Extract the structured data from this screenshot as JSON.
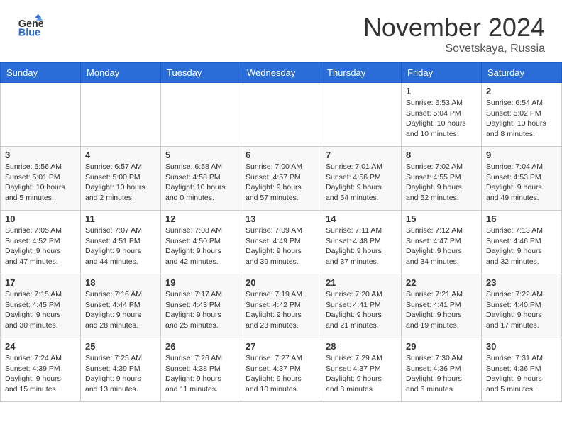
{
  "header": {
    "logo_general": "General",
    "logo_blue": "Blue",
    "month": "November 2024",
    "location": "Sovetskaya, Russia"
  },
  "weekdays": [
    "Sunday",
    "Monday",
    "Tuesday",
    "Wednesday",
    "Thursday",
    "Friday",
    "Saturday"
  ],
  "weeks": [
    [
      {
        "day": "",
        "info": ""
      },
      {
        "day": "",
        "info": ""
      },
      {
        "day": "",
        "info": ""
      },
      {
        "day": "",
        "info": ""
      },
      {
        "day": "",
        "info": ""
      },
      {
        "day": "1",
        "info": "Sunrise: 6:53 AM\nSunset: 5:04 PM\nDaylight: 10 hours\nand 10 minutes."
      },
      {
        "day": "2",
        "info": "Sunrise: 6:54 AM\nSunset: 5:02 PM\nDaylight: 10 hours\nand 8 minutes."
      }
    ],
    [
      {
        "day": "3",
        "info": "Sunrise: 6:56 AM\nSunset: 5:01 PM\nDaylight: 10 hours\nand 5 minutes."
      },
      {
        "day": "4",
        "info": "Sunrise: 6:57 AM\nSunset: 5:00 PM\nDaylight: 10 hours\nand 2 minutes."
      },
      {
        "day": "5",
        "info": "Sunrise: 6:58 AM\nSunset: 4:58 PM\nDaylight: 10 hours\nand 0 minutes."
      },
      {
        "day": "6",
        "info": "Sunrise: 7:00 AM\nSunset: 4:57 PM\nDaylight: 9 hours\nand 57 minutes."
      },
      {
        "day": "7",
        "info": "Sunrise: 7:01 AM\nSunset: 4:56 PM\nDaylight: 9 hours\nand 54 minutes."
      },
      {
        "day": "8",
        "info": "Sunrise: 7:02 AM\nSunset: 4:55 PM\nDaylight: 9 hours\nand 52 minutes."
      },
      {
        "day": "9",
        "info": "Sunrise: 7:04 AM\nSunset: 4:53 PM\nDaylight: 9 hours\nand 49 minutes."
      }
    ],
    [
      {
        "day": "10",
        "info": "Sunrise: 7:05 AM\nSunset: 4:52 PM\nDaylight: 9 hours\nand 47 minutes."
      },
      {
        "day": "11",
        "info": "Sunrise: 7:07 AM\nSunset: 4:51 PM\nDaylight: 9 hours\nand 44 minutes."
      },
      {
        "day": "12",
        "info": "Sunrise: 7:08 AM\nSunset: 4:50 PM\nDaylight: 9 hours\nand 42 minutes."
      },
      {
        "day": "13",
        "info": "Sunrise: 7:09 AM\nSunset: 4:49 PM\nDaylight: 9 hours\nand 39 minutes."
      },
      {
        "day": "14",
        "info": "Sunrise: 7:11 AM\nSunset: 4:48 PM\nDaylight: 9 hours\nand 37 minutes."
      },
      {
        "day": "15",
        "info": "Sunrise: 7:12 AM\nSunset: 4:47 PM\nDaylight: 9 hours\nand 34 minutes."
      },
      {
        "day": "16",
        "info": "Sunrise: 7:13 AM\nSunset: 4:46 PM\nDaylight: 9 hours\nand 32 minutes."
      }
    ],
    [
      {
        "day": "17",
        "info": "Sunrise: 7:15 AM\nSunset: 4:45 PM\nDaylight: 9 hours\nand 30 minutes."
      },
      {
        "day": "18",
        "info": "Sunrise: 7:16 AM\nSunset: 4:44 PM\nDaylight: 9 hours\nand 28 minutes."
      },
      {
        "day": "19",
        "info": "Sunrise: 7:17 AM\nSunset: 4:43 PM\nDaylight: 9 hours\nand 25 minutes."
      },
      {
        "day": "20",
        "info": "Sunrise: 7:19 AM\nSunset: 4:42 PM\nDaylight: 9 hours\nand 23 minutes."
      },
      {
        "day": "21",
        "info": "Sunrise: 7:20 AM\nSunset: 4:41 PM\nDaylight: 9 hours\nand 21 minutes."
      },
      {
        "day": "22",
        "info": "Sunrise: 7:21 AM\nSunset: 4:41 PM\nDaylight: 9 hours\nand 19 minutes."
      },
      {
        "day": "23",
        "info": "Sunrise: 7:22 AM\nSunset: 4:40 PM\nDaylight: 9 hours\nand 17 minutes."
      }
    ],
    [
      {
        "day": "24",
        "info": "Sunrise: 7:24 AM\nSunset: 4:39 PM\nDaylight: 9 hours\nand 15 minutes."
      },
      {
        "day": "25",
        "info": "Sunrise: 7:25 AM\nSunset: 4:39 PM\nDaylight: 9 hours\nand 13 minutes."
      },
      {
        "day": "26",
        "info": "Sunrise: 7:26 AM\nSunset: 4:38 PM\nDaylight: 9 hours\nand 11 minutes."
      },
      {
        "day": "27",
        "info": "Sunrise: 7:27 AM\nSunset: 4:37 PM\nDaylight: 9 hours\nand 10 minutes."
      },
      {
        "day": "28",
        "info": "Sunrise: 7:29 AM\nSunset: 4:37 PM\nDaylight: 9 hours\nand 8 minutes."
      },
      {
        "day": "29",
        "info": "Sunrise: 7:30 AM\nSunset: 4:36 PM\nDaylight: 9 hours\nand 6 minutes."
      },
      {
        "day": "30",
        "info": "Sunrise: 7:31 AM\nSunset: 4:36 PM\nDaylight: 9 hours\nand 5 minutes."
      }
    ]
  ]
}
